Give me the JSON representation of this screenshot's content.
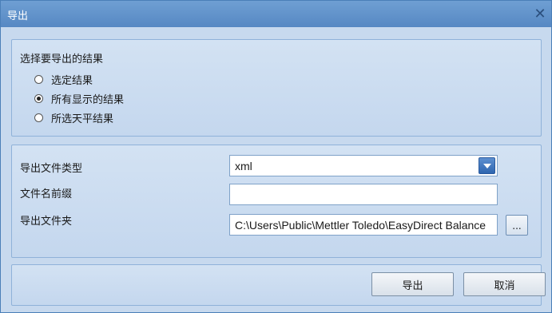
{
  "window": {
    "title": "导出"
  },
  "results_group": {
    "title": "选择要导出的结果",
    "options": [
      {
        "label": "选定结果",
        "checked": false
      },
      {
        "label": "所有显示的结果",
        "checked": true
      },
      {
        "label": "所选天平结果",
        "checked": false
      }
    ]
  },
  "settings": {
    "file_type_label": "导出文件类型",
    "file_type_value": "xml",
    "prefix_label": "文件名前缀",
    "prefix_value": "",
    "folder_label": "导出文件夹",
    "folder_value": "C:\\Users\\Public\\Mettler Toledo\\EasyDirect Balance",
    "browse_label": "..."
  },
  "footer": {
    "export_label": "导出",
    "cancel_label": "取消"
  }
}
